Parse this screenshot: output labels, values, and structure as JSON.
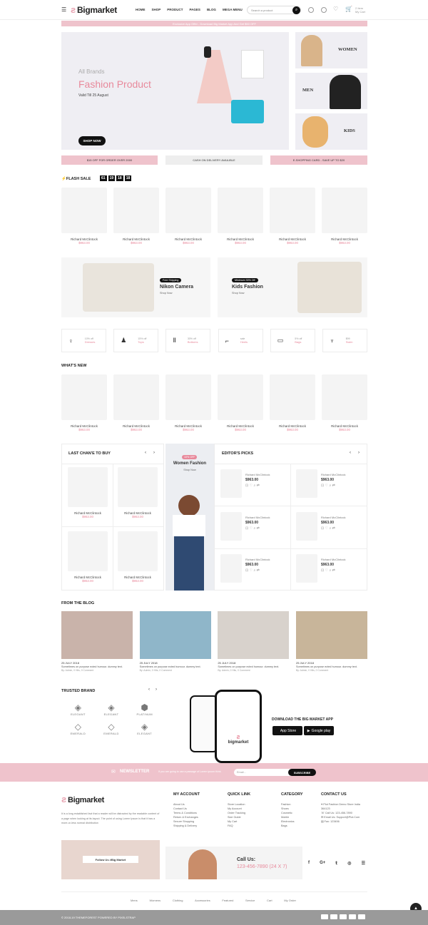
{
  "header": {
    "logo": "Bigmarket",
    "nav": [
      "HOME",
      "SHOP",
      "PRODUCT",
      "PAGES",
      "BLOG",
      "MEGA MENU"
    ],
    "search_placeholder": "Search a product",
    "cart_items": "2 Item",
    "cart_total": "My Cart"
  },
  "promo_bar": "Exclusive App Offer - Download Big Market App And Get $50 OFF",
  "hero": {
    "kicker": "All Brands",
    "title": "Fashion Product",
    "sub": "Valid Till 25 August",
    "cta": "SHOP NOW"
  },
  "side_banners": [
    "WOMEN",
    "MEN",
    "KIDS"
  ],
  "strip": [
    "$15 OFF FOR ORDER OVER 2000",
    "CASH ON DELIVERY AVAILIBLE",
    "E-SHOPPING CARD - SAVE UP TO $20"
  ],
  "flash_sale": {
    "title": "FLASH SALE",
    "timer": [
      "61",
      "19",
      "18",
      "18"
    ]
  },
  "flash_products": [
    {
      "name": "Richard McClintock",
      "price": "$963.00"
    },
    {
      "name": "Richard McClintock",
      "price": "$963.00"
    },
    {
      "name": "Richard McClintock",
      "price": "$963.00"
    },
    {
      "name": "Richard McClintock",
      "price": "$963.00"
    },
    {
      "name": "Richard McClintock",
      "price": "$963.00"
    },
    {
      "name": "Richard McClintock",
      "price": "$963.00"
    }
  ],
  "mid_banners": [
    {
      "tag": "Free Shipping",
      "title": "Nikon Camera",
      "link": "Shop Now"
    },
    {
      "tag": "Minimum 30% Off",
      "title": "Kids Fashion",
      "link": "Shop Now"
    }
  ],
  "categories": [
    {
      "pct": "10% off",
      "name": "Dresses"
    },
    {
      "pct": "15% off",
      "name": "Tops"
    },
    {
      "pct": "30% off",
      "name": "Bottoms"
    },
    {
      "pct": "sale",
      "name": "Heels"
    },
    {
      "pct": "5% off",
      "name": "Bags"
    },
    {
      "pct": "$99",
      "name": "Swim"
    }
  ],
  "whats_new": {
    "title": "WHAT'S NEW",
    "products": [
      {
        "name": "Richard McClintock",
        "price": "$963.00"
      },
      {
        "name": "Richard McClintock",
        "price": "$963.00"
      },
      {
        "name": "Richard McClintock",
        "price": "$963.00"
      },
      {
        "name": "Richard McClintock",
        "price": "$963.00"
      },
      {
        "name": "Richard McClintock",
        "price": "$963.00"
      },
      {
        "name": "Richard McClintock",
        "price": "$963.00"
      }
    ]
  },
  "last_chance": {
    "title": "LAST CHAN'E TO BUY",
    "products": [
      {
        "name": "Richard McClintock",
        "price": "$963.00"
      },
      {
        "name": "Richard McClintock",
        "price": "$963.00"
      },
      {
        "name": "Richard McClintock",
        "price": "$963.00"
      },
      {
        "name": "Richard McClintock",
        "price": "$963.00"
      }
    ]
  },
  "women_banner": {
    "tag": "10% OFF",
    "title": "Women Fashion",
    "link": "Shop Now"
  },
  "editors": {
    "title": "EDITOR'S PICKS",
    "products": [
      {
        "name": "Richard McClintock",
        "price": "$963.00"
      },
      {
        "name": "Richard McClintock",
        "price": "$963.00"
      },
      {
        "name": "Richard McClintock",
        "price": "$963.00"
      },
      {
        "name": "Richard McClintock",
        "price": "$963.00"
      },
      {
        "name": "Richard McClintock",
        "price": "$963.00"
      },
      {
        "name": "Richard McClintock",
        "price": "$963.00"
      }
    ]
  },
  "blog": {
    "title": "FROM THE BLOG",
    "posts": [
      {
        "date": "25 JULY 2018",
        "text": "Sometimes on purpose ected humour. dummy text.",
        "meta": "By: Admin, 0 Hits, 0 Comment"
      },
      {
        "date": "25 JULY 2018",
        "text": "Sometimes on purpose ected humour. dummy text.",
        "meta": "By: Admin, 0 Hits, 0 Comment"
      },
      {
        "date": "25 JULY 2018",
        "text": "Sometimes on purpose ected humour. dummy text.",
        "meta": "By: Admin, 0 Hits, 0 Comment"
      },
      {
        "date": "25 JULY 2018",
        "text": "Sometimes on purpose ected humour. dummy text.",
        "meta": "By: Admin, 0 Hits, 0 Comment"
      }
    ]
  },
  "brands": {
    "title": "TRUSTED BRAND",
    "items": [
      "ELEGANT",
      "ELEGANT",
      "PLATINUM",
      "EMERALD",
      "EMERALD",
      "ELEGANT"
    ]
  },
  "app": {
    "title": "DOWNLOAD THE BIG MARKET APP",
    "store1": "App Store",
    "store2": "Google play",
    "phone_logo": "bigmarket"
  },
  "newsletter": {
    "title": "NEWSLETTER",
    "text": "If you are going to use a passage of Lorem ipsum think.",
    "placeholder": "Email...",
    "btn": "SUBSCRIBE"
  },
  "footer": {
    "about": "It is a long established fact that a reader will be distracted by the readable content of a page when looking at its layout. The point of using Lorem Ipsum is that it has a more-or-less normal distribution",
    "follow": "Follow Us #Big Market",
    "cols": [
      {
        "title": "MY ACCOUNT",
        "items": [
          "About Us",
          "Contact Us",
          "Terms & Conditions",
          "Return & Exchanges",
          "Secure Shopping",
          "Shipping & Delivery"
        ]
      },
      {
        "title": "QUICK LINK",
        "items": [
          "Store Location",
          "My Account",
          "Order Tracking",
          "Size Guide",
          "My Cart",
          "FAQ"
        ]
      },
      {
        "title": "CATEGORY",
        "items": [
          "Fashion",
          "Shoes",
          "Cosmetic",
          "Mobile",
          "Electronics",
          "Bags"
        ]
      },
      {
        "title": "CONTACT US",
        "items": [
          "Plot Fashion Demo Store India 364123",
          "Call Us: 123-456-7890",
          "Email Us: Support@Plot.Com",
          "Fax: 123456"
        ]
      }
    ],
    "call_label": "Call Us:",
    "call_num": "123-456-7890 (24 X 7)",
    "bottom_links": [
      "Mens",
      "Womens",
      "Clothing",
      "Accessories",
      "Featured",
      "Service",
      "Cart",
      "My Order"
    ],
    "copyright": "© 2018-19 THEMEFOREST POWERED BY PIXELSTRAP"
  },
  "colors": {
    "accent": "#e8899b",
    "pink_bg": "#efc3cc",
    "dark": "#111111"
  }
}
